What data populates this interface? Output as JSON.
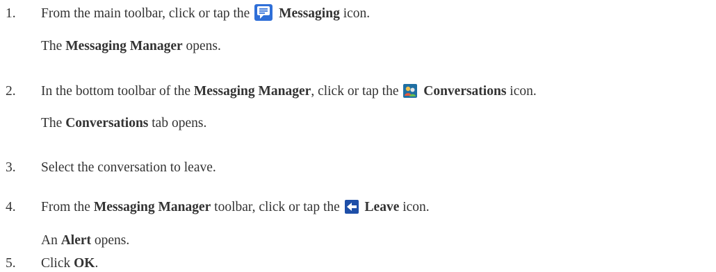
{
  "steps": [
    {
      "number": "1.",
      "pre": "From the main toolbar, click or tap the",
      "bold": "Messaging",
      "post": "icon.",
      "icon": "messaging-icon",
      "result": {
        "pre": "The",
        "bold": "Messaging Manager",
        "post": "opens."
      }
    },
    {
      "number": "2.",
      "pre": "In the bottom toolbar of the",
      "bold_a": "Messaging Manager",
      "mid": ", click or tap the",
      "bold": "Conversations",
      "post": "icon.",
      "icon": "conversations-icon",
      "result": {
        "pre": "The",
        "bold": "Conversations",
        "post": "tab opens."
      }
    },
    {
      "number": "3.",
      "text": "Select the conversation to leave."
    },
    {
      "number": "4.",
      "pre": "From the",
      "bold_a": "Messaging Manager",
      "mid": "toolbar, click or tap the",
      "bold": "Leave",
      "post": "icon.",
      "icon": "leave-icon",
      "result": {
        "pre": "An",
        "bold": "Alert",
        "post": "opens."
      }
    },
    {
      "number": "5.",
      "pre": "Click",
      "bold": "OK",
      "post": "."
    }
  ],
  "colors": {
    "text": "#333333",
    "messaging_icon": "#2f6fd8",
    "conversations_icon": "#1f6fa3",
    "leave_icon": "#1e4fa8"
  }
}
